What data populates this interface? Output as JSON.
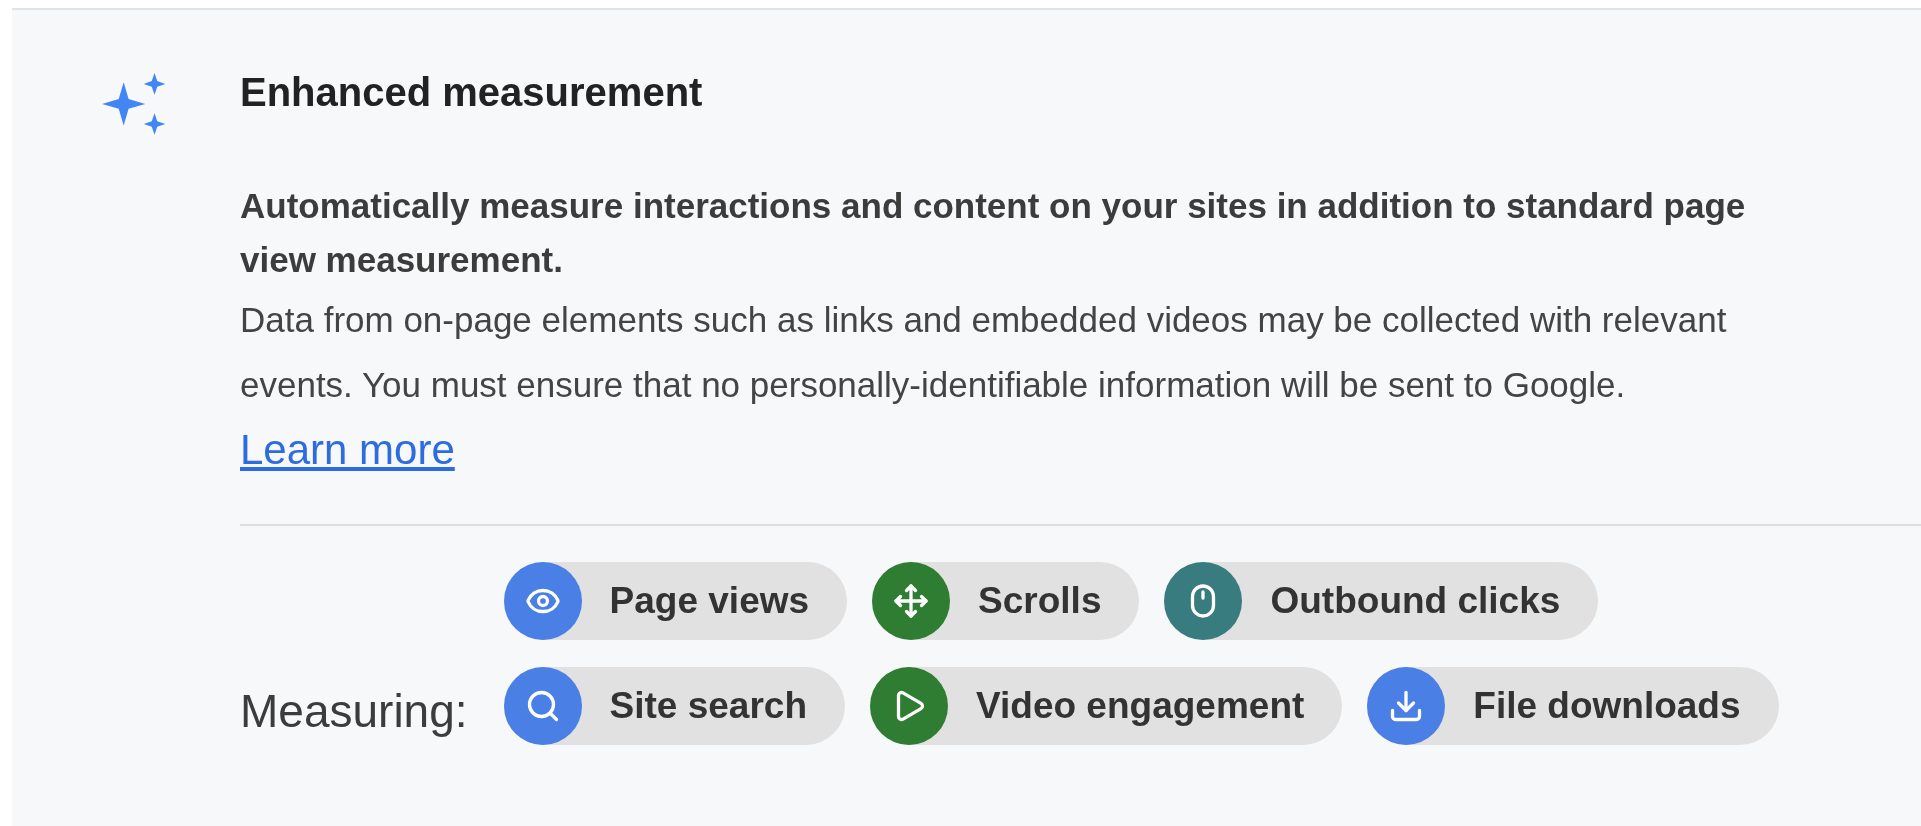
{
  "card": {
    "title": "Enhanced measurement",
    "summary": "Automatically measure interactions and content on your sites in addition to standard page view measurement.",
    "note": "Data from on-page elements such as links and embedded videos may be collected with relevant events. You must ensure that no personally-identifiable information will be sent to Google.",
    "link": "Learn more",
    "measuring_label": "Measuring:",
    "events": [
      [
        {
          "label": "Page views",
          "color": "#4a7fe6"
        },
        {
          "label": "Scrolls",
          "color": "#2e7d32"
        },
        {
          "label": "Outbound clicks",
          "color": "#387c80"
        }
      ],
      [
        {
          "label": "Site search",
          "color": "#4a7fe6"
        },
        {
          "label": "Video engagement",
          "color": "#2e7d32"
        },
        {
          "label": "File downloads",
          "color": "#4a7fe6"
        }
      ]
    ]
  }
}
